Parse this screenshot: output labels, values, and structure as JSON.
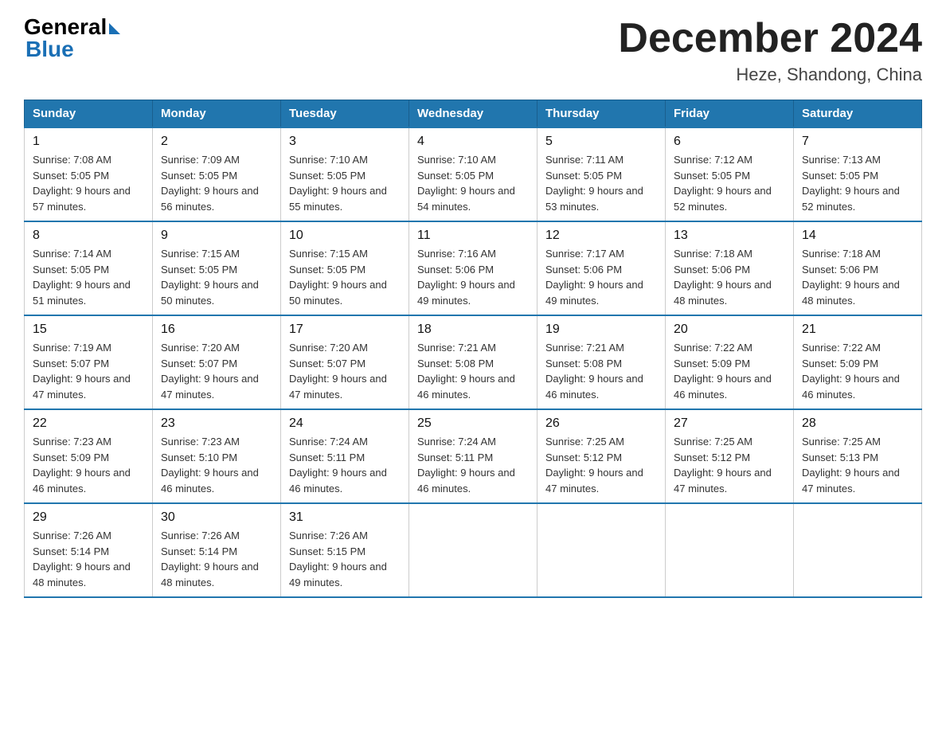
{
  "logo": {
    "general": "General",
    "blue": "Blue"
  },
  "header": {
    "title": "December 2024",
    "subtitle": "Heze, Shandong, China"
  },
  "days_of_week": [
    "Sunday",
    "Monday",
    "Tuesday",
    "Wednesday",
    "Thursday",
    "Friday",
    "Saturday"
  ],
  "weeks": [
    [
      {
        "day": "1",
        "sunrise": "7:08 AM",
        "sunset": "5:05 PM",
        "daylight": "9 hours and 57 minutes."
      },
      {
        "day": "2",
        "sunrise": "7:09 AM",
        "sunset": "5:05 PM",
        "daylight": "9 hours and 56 minutes."
      },
      {
        "day": "3",
        "sunrise": "7:10 AM",
        "sunset": "5:05 PM",
        "daylight": "9 hours and 55 minutes."
      },
      {
        "day": "4",
        "sunrise": "7:10 AM",
        "sunset": "5:05 PM",
        "daylight": "9 hours and 54 minutes."
      },
      {
        "day": "5",
        "sunrise": "7:11 AM",
        "sunset": "5:05 PM",
        "daylight": "9 hours and 53 minutes."
      },
      {
        "day": "6",
        "sunrise": "7:12 AM",
        "sunset": "5:05 PM",
        "daylight": "9 hours and 52 minutes."
      },
      {
        "day": "7",
        "sunrise": "7:13 AM",
        "sunset": "5:05 PM",
        "daylight": "9 hours and 52 minutes."
      }
    ],
    [
      {
        "day": "8",
        "sunrise": "7:14 AM",
        "sunset": "5:05 PM",
        "daylight": "9 hours and 51 minutes."
      },
      {
        "day": "9",
        "sunrise": "7:15 AM",
        "sunset": "5:05 PM",
        "daylight": "9 hours and 50 minutes."
      },
      {
        "day": "10",
        "sunrise": "7:15 AM",
        "sunset": "5:05 PM",
        "daylight": "9 hours and 50 minutes."
      },
      {
        "day": "11",
        "sunrise": "7:16 AM",
        "sunset": "5:06 PM",
        "daylight": "9 hours and 49 minutes."
      },
      {
        "day": "12",
        "sunrise": "7:17 AM",
        "sunset": "5:06 PM",
        "daylight": "9 hours and 49 minutes."
      },
      {
        "day": "13",
        "sunrise": "7:18 AM",
        "sunset": "5:06 PM",
        "daylight": "9 hours and 48 minutes."
      },
      {
        "day": "14",
        "sunrise": "7:18 AM",
        "sunset": "5:06 PM",
        "daylight": "9 hours and 48 minutes."
      }
    ],
    [
      {
        "day": "15",
        "sunrise": "7:19 AM",
        "sunset": "5:07 PM",
        "daylight": "9 hours and 47 minutes."
      },
      {
        "day": "16",
        "sunrise": "7:20 AM",
        "sunset": "5:07 PM",
        "daylight": "9 hours and 47 minutes."
      },
      {
        "day": "17",
        "sunrise": "7:20 AM",
        "sunset": "5:07 PM",
        "daylight": "9 hours and 47 minutes."
      },
      {
        "day": "18",
        "sunrise": "7:21 AM",
        "sunset": "5:08 PM",
        "daylight": "9 hours and 46 minutes."
      },
      {
        "day": "19",
        "sunrise": "7:21 AM",
        "sunset": "5:08 PM",
        "daylight": "9 hours and 46 minutes."
      },
      {
        "day": "20",
        "sunrise": "7:22 AM",
        "sunset": "5:09 PM",
        "daylight": "9 hours and 46 minutes."
      },
      {
        "day": "21",
        "sunrise": "7:22 AM",
        "sunset": "5:09 PM",
        "daylight": "9 hours and 46 minutes."
      }
    ],
    [
      {
        "day": "22",
        "sunrise": "7:23 AM",
        "sunset": "5:09 PM",
        "daylight": "9 hours and 46 minutes."
      },
      {
        "day": "23",
        "sunrise": "7:23 AM",
        "sunset": "5:10 PM",
        "daylight": "9 hours and 46 minutes."
      },
      {
        "day": "24",
        "sunrise": "7:24 AM",
        "sunset": "5:11 PM",
        "daylight": "9 hours and 46 minutes."
      },
      {
        "day": "25",
        "sunrise": "7:24 AM",
        "sunset": "5:11 PM",
        "daylight": "9 hours and 46 minutes."
      },
      {
        "day": "26",
        "sunrise": "7:25 AM",
        "sunset": "5:12 PM",
        "daylight": "9 hours and 47 minutes."
      },
      {
        "day": "27",
        "sunrise": "7:25 AM",
        "sunset": "5:12 PM",
        "daylight": "9 hours and 47 minutes."
      },
      {
        "day": "28",
        "sunrise": "7:25 AM",
        "sunset": "5:13 PM",
        "daylight": "9 hours and 47 minutes."
      }
    ],
    [
      {
        "day": "29",
        "sunrise": "7:26 AM",
        "sunset": "5:14 PM",
        "daylight": "9 hours and 48 minutes."
      },
      {
        "day": "30",
        "sunrise": "7:26 AM",
        "sunset": "5:14 PM",
        "daylight": "9 hours and 48 minutes."
      },
      {
        "day": "31",
        "sunrise": "7:26 AM",
        "sunset": "5:15 PM",
        "daylight": "9 hours and 49 minutes."
      },
      null,
      null,
      null,
      null
    ]
  ]
}
